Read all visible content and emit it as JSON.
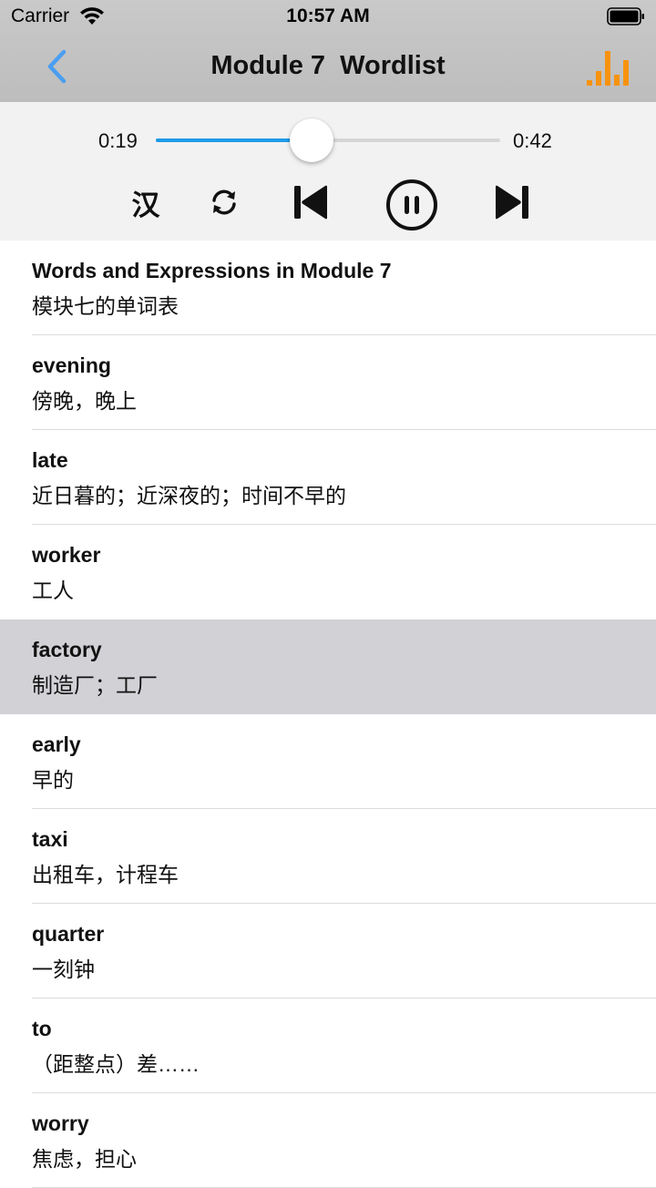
{
  "status": {
    "carrier": "Carrier",
    "time": "10:57 AM"
  },
  "nav": {
    "title": "Module 7  Wordlist",
    "accent_color": "#4a9ef0",
    "stats_color": "#f7930f"
  },
  "player": {
    "current_time": "0:19",
    "total_time": "0:42",
    "progress": 0.452,
    "chinese_toggle_label": "汉",
    "track_color": "#1e9be8"
  },
  "words": [
    {
      "word": "Words and Expressions in Module 7",
      "meaning": "模块七的单词表",
      "selected": false
    },
    {
      "word": "evening",
      "meaning": "傍晚，晚上",
      "selected": false
    },
    {
      "word": "late",
      "meaning": "近日暮的；近深夜的；时间不早的",
      "selected": false
    },
    {
      "word": "worker",
      "meaning": "工人",
      "selected": false
    },
    {
      "word": "factory",
      "meaning": "制造厂；工厂",
      "selected": true
    },
    {
      "word": "early",
      "meaning": "早的",
      "selected": false
    },
    {
      "word": "taxi",
      "meaning": "出租车，计程车",
      "selected": false
    },
    {
      "word": "quarter",
      "meaning": "一刻钟",
      "selected": false
    },
    {
      "word": "to",
      "meaning": "（距整点）差……",
      "selected": false
    },
    {
      "word": "worry",
      "meaning": "焦虑，担心",
      "selected": false
    }
  ]
}
